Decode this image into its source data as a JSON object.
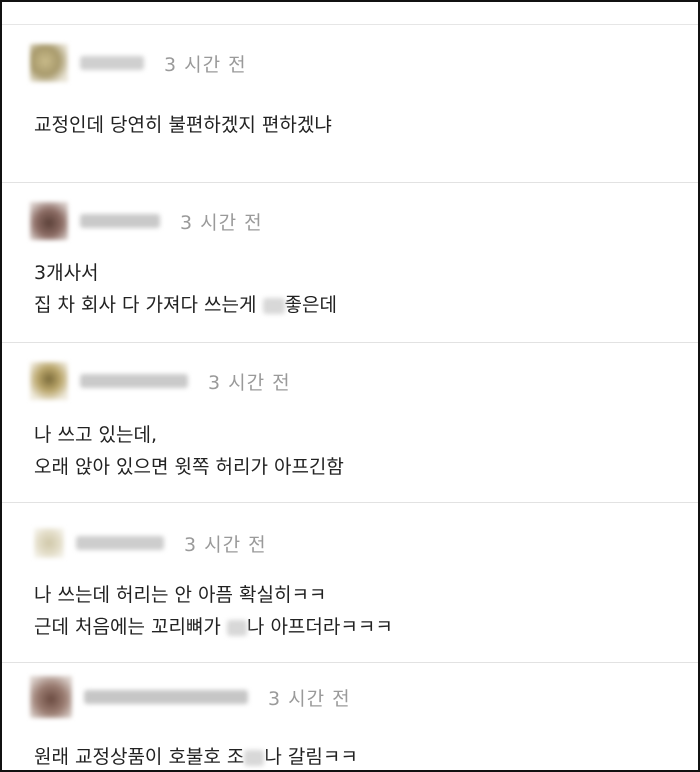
{
  "comments": [
    {
      "time": "3 시간 전",
      "text1": "교정인데 당연히 불편하겠지 편하겠냐",
      "text2": ""
    },
    {
      "time": "3 시간 전",
      "text1": "3개사서",
      "text2a": "집 차 회사 다 가져다 쓰는게 ",
      "text2b": "좋은데"
    },
    {
      "time": "3 시간 전",
      "text1": "나 쓰고 있는데,",
      "text2": "오래 앉아 있으면 윗쪽 허리가 아프긴함"
    },
    {
      "time": "3 시간 전",
      "text1": "나 쓰는데 허리는 안 아픔 확실히ㅋㅋ",
      "text2a": "근데 처음에는 꼬리뼈가 ",
      "text2b": "나 아프더라ㅋㅋㅋ"
    },
    {
      "time": "3 시간 전",
      "text1a": "원래 교정상품이 호불호 조",
      "text1b": "나 갈림ㅋㅋ"
    }
  ]
}
